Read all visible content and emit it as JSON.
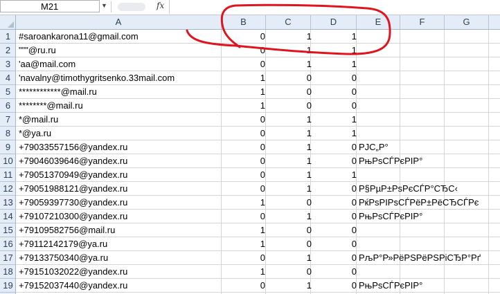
{
  "formula_bar": {
    "name_box": "M21",
    "fx_label": "fx",
    "formula": ""
  },
  "columns": [
    "A",
    "B",
    "C",
    "D",
    "E",
    "F",
    "G"
  ],
  "rows": [
    {
      "num": "1",
      "a": "#saroankarona11@gmail.com",
      "b": "0",
      "c": "1",
      "d": "1",
      "e": ""
    },
    {
      "num": "2",
      "a": "\"\"\"@ru.ru",
      "b": "0",
      "c": "1",
      "d": "1",
      "e": ""
    },
    {
      "num": "3",
      "a": "'aa@mail.com",
      "b": "0",
      "c": "1",
      "d": "1",
      "e": ""
    },
    {
      "num": "4",
      "a": "'navalny@timothygritsenko.33mail.com",
      "b": "1",
      "c": "0",
      "d": "0",
      "e": ""
    },
    {
      "num": "5",
      "a": "************@mail.ru",
      "b": "1",
      "c": "0",
      "d": "0",
      "e": ""
    },
    {
      "num": "6",
      "a": "********@mail.ru",
      "b": "1",
      "c": "0",
      "d": "0",
      "e": ""
    },
    {
      "num": "7",
      "a": "*@mail.ru",
      "b": "0",
      "c": "1",
      "d": "1",
      "e": ""
    },
    {
      "num": "8",
      "a": "*@ya.ru",
      "b": "0",
      "c": "1",
      "d": "1",
      "e": ""
    },
    {
      "num": "9",
      "a": "+79033557156@yandex.ru",
      "b": "0",
      "c": "1",
      "d": "0",
      "e": "РЈС„Р°"
    },
    {
      "num": "10",
      "a": "+79046039646@yandex.ru",
      "b": "0",
      "c": "1",
      "d": "0",
      "e": "РњРѕСЃРєРІР°"
    },
    {
      "num": "11",
      "a": "+79051370949@yandex.ru",
      "b": "0",
      "c": "1",
      "d": "1",
      "e": ""
    },
    {
      "num": "12",
      "a": "+79051988121@yandex.ru",
      "b": "0",
      "c": "1",
      "d": "0",
      "e": "Р§РµР±РѕРєСЃР°СЂС‹"
    },
    {
      "num": "13",
      "a": "+79059397730@yandex.ru",
      "b": "1",
      "c": "0",
      "d": "0",
      "e": "РќРѕРІРѕСЃРёР±РёСЂСЃРє"
    },
    {
      "num": "14",
      "a": "+79107210300@yandex.ru",
      "b": "0",
      "c": "1",
      "d": "0",
      "e": "РњРѕСЃРєРІР°"
    },
    {
      "num": "15",
      "a": "+79109582756@mail.ru",
      "b": "1",
      "c": "0",
      "d": "0",
      "e": ""
    },
    {
      "num": "16",
      "a": "+79112142179@ya.ru",
      "b": "1",
      "c": "0",
      "d": "0",
      "e": ""
    },
    {
      "num": "17",
      "a": "+79133750340@ya.ru",
      "b": "0",
      "c": "1",
      "d": "0",
      "e": "РљР°Р»РёРЅРёРЅРіСЂР°Рґ"
    },
    {
      "num": "18",
      "a": "+79151032022@yandex.ru",
      "b": "1",
      "c": "0",
      "d": "0",
      "e": ""
    },
    {
      "num": "19",
      "a": "+79152037440@yandex.ru",
      "b": "0",
      "c": "1",
      "d": "0",
      "e": "РњРѕСЃРєРІР°"
    }
  ],
  "colors": {
    "header_bg": "#e4ecf7",
    "header_text": "#27415f",
    "gridline": "#d4d4d4",
    "annotation": "#e0141e"
  },
  "icons": {
    "namebox_dropdown": "chevron-down-icon",
    "formula": "fx-icon"
  }
}
